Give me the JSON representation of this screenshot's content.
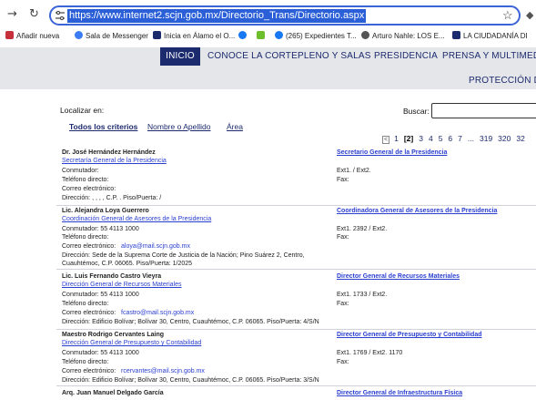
{
  "browser": {
    "url": "https://www.internet2.scjn.gob.mx/Directorio_Trans/Directorio.aspx",
    "bookmarks": [
      "Añadir nueva",
      "Sala de Messenger",
      "Inicia en Álamo el O...",
      "(265) Expedientes T...",
      "Arturo Nahle: LOS E...",
      "LA CIUDADANÍA DI"
    ]
  },
  "nav": {
    "items": [
      "INICIO",
      "CONOCE LA CORTE",
      "PLENO Y SALAS",
      "PRESIDENCIA",
      "PRENSA Y MULTIMEDIA"
    ],
    "row2": "PROTECCIÓN DE"
  },
  "localizar": {
    "label": "Localizar en:",
    "tabs": [
      "Todos los criterios",
      "Nombre o Apellido",
      "Área"
    ],
    "search_label": "Buscar:"
  },
  "pager": {
    "pages": [
      "1",
      "[2]",
      "3",
      "4",
      "5",
      "6",
      "7",
      "...",
      "319",
      "320",
      "32"
    ]
  },
  "entries": [
    {
      "name": "Dr. José Hernández Hernández",
      "department": "Secretaría General de la Presidencia",
      "conmutador": "Conmutador:",
      "telefono": "Teléfono directo:",
      "correo_label": "Correo electrónico:",
      "correo": "",
      "direccion": "Dirección: , , , , C.P. . Piso/Puerta: /",
      "direccion2": "",
      "title": "Secretario General de la Presidencia",
      "ext": "Ext1. / Ext2.",
      "fax": "Fax:"
    },
    {
      "name": "Lic. Alejandra Loya Guerrero",
      "department": "Coordinación General de Asesores de la Presidencia",
      "conmutador": "Conmutador: 55 4113 1000",
      "telefono": "Teléfono directo:",
      "correo_label": "Correo electrónico:",
      "correo": "aloya@mail.scjn.gob.mx",
      "direccion": "Dirección: Sede de la Suprema Corte de Justicia de la Nación; Pino Suárez 2, Centro,",
      "direccion2": "Cuauhtémoc, C.P. 06065. Piso/Puerta: 1/2025",
      "title": "Coordinadora General de Asesores de la Presidencia",
      "ext": "Ext1. 2392 / Ext2.",
      "fax": "Fax:"
    },
    {
      "name": "Lic. Luis Fernando Castro Vieyra",
      "department": "Dirección General de Recursos Materiales",
      "conmutador": "Conmutador: 55 4113 1000",
      "telefono": "Teléfono directo:",
      "correo_label": "Correo electrónico:",
      "correo": "fcastro@mail.scjn.gob.mx",
      "direccion": "Dirección: Edificio Bolívar; Bolívar 30, Centro, Cuauhtémoc, C.P. 06065. Piso/Puerta: 4/S/N",
      "direccion2": "",
      "title": "Director General de Recursos Materiales",
      "ext": "Ext1. 1733 / Ext2.",
      "fax": "Fax:"
    },
    {
      "name": "Maestro Rodrigo Cervantes Laing",
      "department": "Dirección General de Presupuesto y Contabilidad",
      "conmutador": "Conmutador: 55 4113 1000",
      "telefono": "Teléfono directo:",
      "correo_label": "Correo electrónico:",
      "correo": "rcervantes@mail.scjn.gob.mx",
      "direccion": "Dirección: Edificio Bolívar; Bolívar 30, Centro, Cuauhtémoc, C.P. 06065. Piso/Puerta: 3/S/N",
      "direccion2": "",
      "title": "Director General de Presupuesto y Contabilidad",
      "ext": "Ext1. 1769 / Ext2. 1170",
      "fax": "Fax:"
    },
    {
      "name": "Arq. Juan Manuel Delgado García",
      "department": "",
      "conmutador": "",
      "telefono": "",
      "correo_label": "",
      "correo": "",
      "direccion": "",
      "direccion2": "",
      "title": "Director General de Infraestructura Física",
      "ext": "",
      "fax": ""
    }
  ]
}
